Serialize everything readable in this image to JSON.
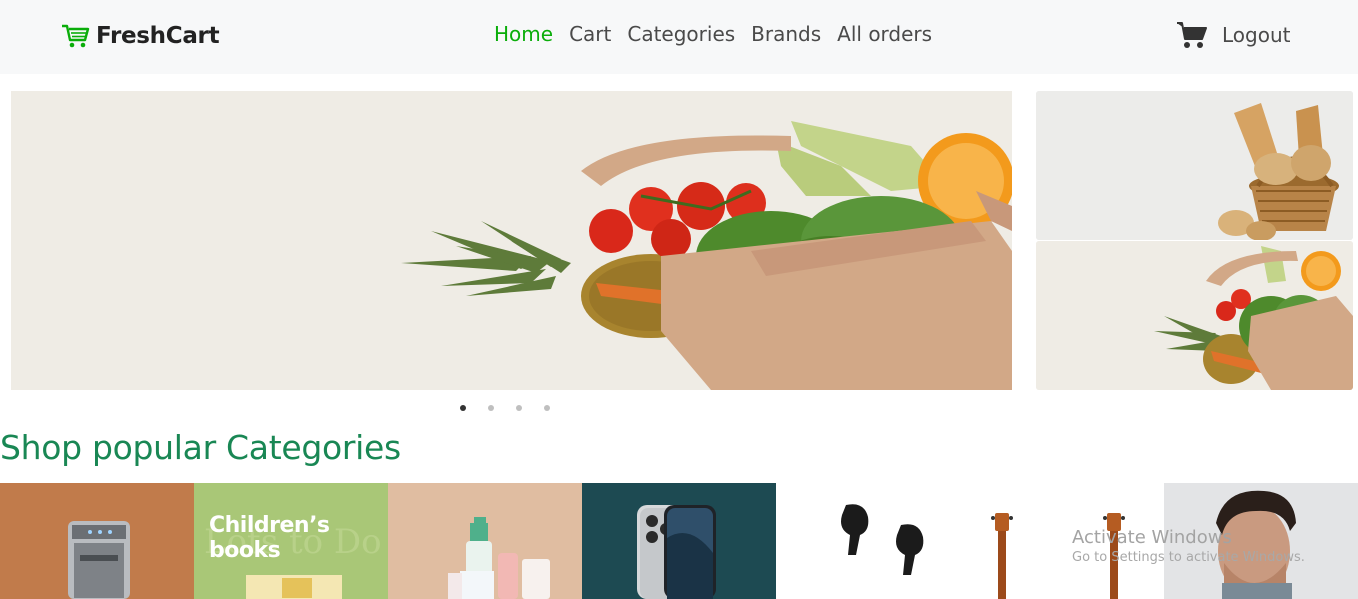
{
  "brand": {
    "name": "FreshCart",
    "accent": "#0aad0a"
  },
  "nav": {
    "links": [
      {
        "label": "Home",
        "active": true
      },
      {
        "label": "Cart",
        "active": false
      },
      {
        "label": "Categories",
        "active": false
      },
      {
        "label": "Brands",
        "active": false
      },
      {
        "label": "All orders",
        "active": false
      }
    ],
    "logout_label": "Logout",
    "cart_icon": "shopping-cart-icon"
  },
  "hero": {
    "slides_count": 4,
    "active_slide": 1
  },
  "section": {
    "title": "Shop popular Categories",
    "title_color": "#198754"
  },
  "categories": [
    {
      "name": "appliances"
    },
    {
      "name": "books",
      "banner_text": "Children’s books"
    },
    {
      "name": "beauty"
    },
    {
      "name": "mobiles"
    },
    {
      "name": "electronics"
    },
    {
      "name": "music"
    },
    {
      "name": "men-fashion"
    }
  ],
  "watermark": {
    "title": "Activate Windows",
    "subtitle": "Go to Settings to activate Windows."
  }
}
